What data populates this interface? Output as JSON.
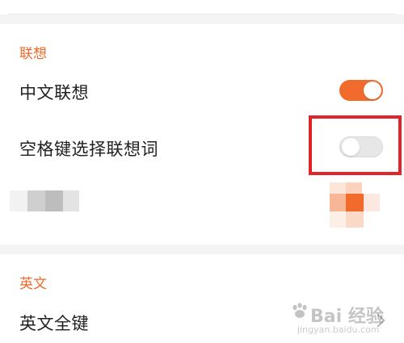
{
  "sections": {
    "association": {
      "title": "联想",
      "chinese_association": {
        "label": "中文联想",
        "enabled": true
      },
      "space_select": {
        "label": "空格键选择联想词",
        "enabled": false
      },
      "obscured_row": {
        "label": "",
        "enabled": true
      }
    },
    "english": {
      "title": "英文",
      "full_keyboard": {
        "label": "英文全键"
      }
    }
  },
  "watermark": {
    "brand": "Bai 经验",
    "url": "jingyan.baidu.com"
  },
  "colors": {
    "accent": "#f06b2c",
    "highlight_box": "#e0242a",
    "toggle_off": "#e7e7e7"
  }
}
